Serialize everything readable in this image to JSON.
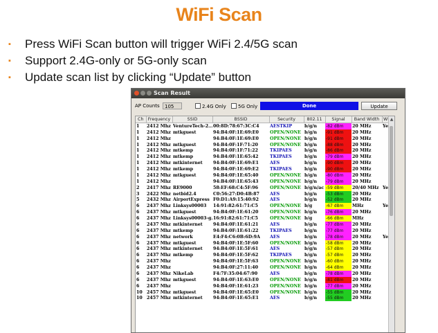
{
  "slide": {
    "title": "WiFi Scan",
    "bullets": [
      "Press WiFi Scan button will trigger WiFi 2.4/5G scan",
      "Support 2.4G-only or 5G-only scan",
      "Update scan list by clicking “Update” button"
    ],
    "bullet_marker": "▪"
  },
  "window": {
    "title": "Scan Result",
    "ap_counts_label": "AP Counts",
    "ap_counts_value": "105",
    "only24_label": "2.4G Only",
    "only5_label": "5G Only",
    "progress_text": "Done",
    "progress_value": 1.0,
    "update_label": "Update",
    "columns": [
      "Ch",
      "Frequency",
      "SSID",
      "BSSID",
      "Security",
      "802.11",
      "Signal",
      "Band Width",
      "WPS"
    ],
    "colors": {
      "red": "#ee1111",
      "magenta": "#ff22ff",
      "yellow": "#ffff00",
      "green": "#22cc22",
      "sec_green": "#009900",
      "sec_blue": "#1414b4"
    },
    "rows": [
      {
        "ch": "1",
        "freq": "2412 Mhz",
        "ssid": "VentureTech-2…",
        "bssid": "00:8D:78:67:3C:C4",
        "sec": "AESTKIP",
        "sec_color": "blue",
        "std": "b/g/n",
        "signal": "-82 dBm",
        "sig_color": "magenta",
        "bw": "20 MHz",
        "wps": "Yes"
      },
      {
        "ch": "1",
        "freq": "2412 Mhz",
        "ssid": "mtkguest",
        "bssid": "94:B4:0F:1E:69:E0",
        "sec": "OPEN/NONE",
        "sec_color": "green",
        "std": "b/g/n",
        "signal": "-91 dBm",
        "sig_color": "red",
        "bw": "20 MHz",
        "wps": ""
      },
      {
        "ch": "1",
        "freq": "2412 Mhz",
        "ssid": "",
        "bssid": "94:B4:0F:1E:69:E0",
        "sec": "OPEN/NONE",
        "sec_color": "green",
        "std": "b/g/n",
        "signal": "-91 dBm",
        "sig_color": "red",
        "bw": "20 MHz",
        "wps": ""
      },
      {
        "ch": "1",
        "freq": "2412 Mhz",
        "ssid": "mtkguest",
        "bssid": "94:B4:0F:1F:71:20",
        "sec": "OPEN/NONE",
        "sec_color": "green",
        "std": "b/g/n",
        "signal": "-88 dBm",
        "sig_color": "red",
        "bw": "20 MHz",
        "wps": ""
      },
      {
        "ch": "1",
        "freq": "2412 Mhz",
        "ssid": "mtkemp",
        "bssid": "94:B4:0F:1F:71:22",
        "sec": "TKIPAES",
        "sec_color": "blue",
        "std": "b/g/n",
        "signal": "-86 dBm",
        "sig_color": "red",
        "bw": "20 MHz",
        "wps": ""
      },
      {
        "ch": "1",
        "freq": "2412 Mhz",
        "ssid": "mtkemp",
        "bssid": "94:B4:0F:1E:65:42",
        "sec": "TKIPAES",
        "sec_color": "blue",
        "std": "b/g/n",
        "signal": "-79 dBm",
        "sig_color": "magenta",
        "bw": "20 MHz",
        "wps": ""
      },
      {
        "ch": "1",
        "freq": "2412 Mhz",
        "ssid": "mtkinternet",
        "bssid": "94:B4:0F:1E:69:E1",
        "sec": "AES",
        "sec_color": "blue",
        "std": "b/g/n",
        "signal": "-90 dBm",
        "sig_color": "red",
        "bw": "20 MHz",
        "wps": ""
      },
      {
        "ch": "1",
        "freq": "2412 Mhz",
        "ssid": "mtkemp",
        "bssid": "94:B4:0F:1E:69:E2",
        "sec": "TKIPAES",
        "sec_color": "blue",
        "std": "b/g/n",
        "signal": "-90 dBm",
        "sig_color": "red",
        "bw": "20 MHz",
        "wps": ""
      },
      {
        "ch": "1",
        "freq": "2412 Mhz",
        "ssid": "mtkguest",
        "bssid": "94:B4:0F:1E:65:40",
        "sec": "OPEN/NONE",
        "sec_color": "green",
        "std": "b/g/n",
        "signal": "-80 dBm",
        "sig_color": "magenta",
        "bw": "20 MHz",
        "wps": ""
      },
      {
        "ch": "1",
        "freq": "2412 Mhz",
        "ssid": "",
        "bssid": "94:B4:0F:1E:65:43",
        "sec": "OPEN/NONE",
        "sec_color": "green",
        "std": "b/g/n",
        "signal": "-79 dBm",
        "sig_color": "magenta",
        "bw": "20 MHz",
        "wps": ""
      },
      {
        "ch": "2",
        "freq": "2417 Mhz",
        "ssid": "RE9000",
        "bssid": "58:EF:68:C4:5F:96",
        "sec": "OPEN/NONE",
        "sec_color": "green",
        "std": "b/g/n/ac",
        "signal": "-59 dBm",
        "sig_color": "yellow",
        "bw": "20/40 MHz",
        "wps": "Yes"
      },
      {
        "ch": "3",
        "freq": "2422 Mhz",
        "ssid": "netbid2.4",
        "bssid": "C0:56:27:D0:4B:87",
        "sec": "AES",
        "sec_color": "blue",
        "std": "b/g/n",
        "signal": "-53 dBm",
        "sig_color": "green",
        "bw": "20 MHz",
        "wps": ""
      },
      {
        "ch": "5",
        "freq": "2432 Mhz",
        "ssid": "AirportExpress",
        "bssid": "F0:D1:A9:15:40:92",
        "sec": "AES",
        "sec_color": "blue",
        "std": "b/g/n",
        "signal": "-52 dBm",
        "sig_color": "green",
        "bw": "20 MHz",
        "wps": ""
      },
      {
        "ch": "6",
        "freq": "2437 Mhz",
        "ssid": "Linksys00003",
        "bssid": "14:91:82:61:71:C5",
        "sec": "OPEN/NONE",
        "sec_color": "green",
        "std": "b/g",
        "signal": "-67 dBm",
        "sig_color": "yellow",
        "bw": "MHz",
        "wps": "Yes"
      },
      {
        "ch": "6",
        "freq": "2437 Mhz",
        "ssid": "mtkguest",
        "bssid": "94:B4:0F:1E:61:20",
        "sec": "OPEN/NONE",
        "sec_color": "green",
        "std": "b/g/n",
        "signal": "-76 dBm",
        "sig_color": "magenta",
        "bw": "20 MHz",
        "wps": ""
      },
      {
        "ch": "6",
        "freq": "2437 Mhz",
        "ssid": "Linksys00003-g…",
        "bssid": "16:91:82:61:71:C5",
        "sec": "OPEN/NONE",
        "sec_color": "green",
        "std": "b/g",
        "signal": "-66 dBm",
        "sig_color": "yellow",
        "bw": "MHz",
        "wps": ""
      },
      {
        "ch": "6",
        "freq": "2437 Mhz",
        "ssid": "mtkinternet",
        "bssid": "94:B4:0F:1E:61:21",
        "sec": "AES",
        "sec_color": "blue",
        "std": "b/g/n",
        "signal": "-77 dBm",
        "sig_color": "magenta",
        "bw": "20 MHz",
        "wps": ""
      },
      {
        "ch": "6",
        "freq": "2437 Mhz",
        "ssid": "mtkemp",
        "bssid": "94:B4:0F:1E:61:22",
        "sec": "TKIPAES",
        "sec_color": "blue",
        "std": "b/g/n",
        "signal": "-77 dBm",
        "sig_color": "magenta",
        "bw": "20 MHz",
        "wps": ""
      },
      {
        "ch": "6",
        "freq": "2437 Mhz",
        "ssid": "network",
        "bssid": "E4:F4:C6:0B:6D:9A",
        "sec": "AES",
        "sec_color": "blue",
        "std": "b/g/n",
        "signal": "-78 dBm",
        "sig_color": "magenta",
        "bw": "20 MHz",
        "wps": "Yes"
      },
      {
        "ch": "6",
        "freq": "2437 Mhz",
        "ssid": "mtkguest",
        "bssid": "94:B4:0F:1E:5F:60",
        "sec": "OPEN/NONE",
        "sec_color": "green",
        "std": "b/g/n",
        "signal": "-58 dBm",
        "sig_color": "yellow",
        "bw": "20 MHz",
        "wps": ""
      },
      {
        "ch": "6",
        "freq": "2437 Mhz",
        "ssid": "mtkinternet",
        "bssid": "94:B4:0F:1E:5F:61",
        "sec": "AES",
        "sec_color": "blue",
        "std": "b/g/n",
        "signal": "-57 dBm",
        "sig_color": "yellow",
        "bw": "20 MHz",
        "wps": ""
      },
      {
        "ch": "6",
        "freq": "2437 Mhz",
        "ssid": "mtkemp",
        "bssid": "94:B4:0F:1E:5F:62",
        "sec": "TKIPAES",
        "sec_color": "blue",
        "std": "b/g/n",
        "signal": "-57 dBm",
        "sig_color": "yellow",
        "bw": "20 MHz",
        "wps": ""
      },
      {
        "ch": "6",
        "freq": "2437 Mhz",
        "ssid": "",
        "bssid": "94:B4:0F:1E:5F:63",
        "sec": "OPEN/NONE",
        "sec_color": "green",
        "std": "b/g/n",
        "signal": "-60 dBm",
        "sig_color": "yellow",
        "bw": "20 MHz",
        "wps": ""
      },
      {
        "ch": "6",
        "freq": "2437 Mhz",
        "ssid": "",
        "bssid": "94:B4:0F:27:11:40",
        "sec": "OPEN/NONE",
        "sec_color": "green",
        "std": "b/g/n",
        "signal": "-64 dBm",
        "sig_color": "yellow",
        "bw": "20 MHz",
        "wps": ""
      },
      {
        "ch": "6",
        "freq": "2437 Mhz",
        "ssid": "NikeLab",
        "bssid": "F4:7F:35:04:67:90",
        "sec": "AES",
        "sec_color": "blue",
        "std": "b/g/n",
        "signal": "-78 dBm",
        "sig_color": "magenta",
        "bw": "20 MHz",
        "wps": ""
      },
      {
        "ch": "6",
        "freq": "2437 Mhz",
        "ssid": "mtkguest",
        "bssid": "94:B4:0F:1E:63:E0",
        "sec": "OPEN/NONE",
        "sec_color": "green",
        "std": "b/g/n",
        "signal": "-81 dBm",
        "sig_color": "red",
        "bw": "20 MHz",
        "wps": ""
      },
      {
        "ch": "6",
        "freq": "2437 Mhz",
        "ssid": "",
        "bssid": "94:B4:0F:1E:61:23",
        "sec": "OPEN/NONE",
        "sec_color": "green",
        "std": "b/g/n",
        "signal": "-77 dBm",
        "sig_color": "magenta",
        "bw": "20 MHz",
        "wps": ""
      },
      {
        "ch": "10",
        "freq": "2457 Mhz",
        "ssid": "mtkguest",
        "bssid": "94:B4:0F:1E:65:E0",
        "sec": "OPEN/NONE",
        "sec_color": "green",
        "std": "b/g/n",
        "signal": "-55 dBm",
        "sig_color": "green",
        "bw": "20 MHz",
        "wps": ""
      },
      {
        "ch": "10",
        "freq": "2457 Mhz",
        "ssid": "mtkinternet",
        "bssid": "94:B4:0F:1E:65:E1",
        "sec": "AES",
        "sec_color": "blue",
        "std": "b/g/n",
        "signal": "-55 dBm",
        "sig_color": "green",
        "bw": "20 MHz",
        "wps": ""
      }
    ]
  }
}
